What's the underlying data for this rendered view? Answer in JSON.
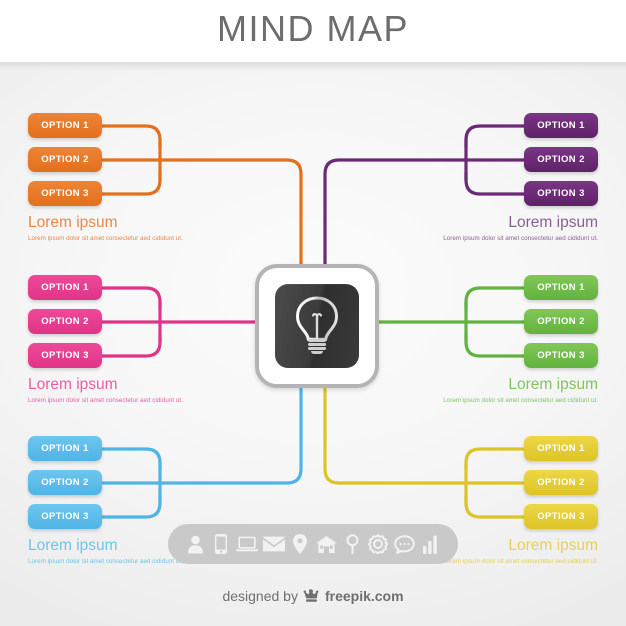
{
  "header": {
    "title": "MIND MAP"
  },
  "center": {
    "icon": "lightbulb-icon",
    "frame_color": "#b4b4b4",
    "tile_color": "#3b3b3b"
  },
  "branches": [
    {
      "id": "orange",
      "position": "top-left",
      "color": "#e8741f",
      "line_color": "#e2701d",
      "text_color": "#e8884a",
      "options": [
        "OPTION 1",
        "OPTION 2",
        "OPTION 3"
      ],
      "caption": {
        "heading": "Lorem ipsum",
        "subtext": "Lorem ipsum dolor sit amet consectetur aed cididunt ut."
      }
    },
    {
      "id": "pink",
      "position": "middle-left",
      "color": "#e5338a",
      "line_color": "#e03487",
      "text_color": "#ef5ba3",
      "options": [
        "OPTION 1",
        "OPTION 2",
        "OPTION 3"
      ],
      "caption": {
        "heading": "Lorem ipsum",
        "subtext": "Lorem ipsum dolor sit amet consectetur aed cididunt ut."
      }
    },
    {
      "id": "blue",
      "position": "bottom-left",
      "color": "#56b9e8",
      "line_color": "#4fb4e6",
      "text_color": "#71c3e9",
      "options": [
        "OPTION 1",
        "OPTION 2",
        "OPTION 3"
      ],
      "caption": {
        "heading": "Lorem ipsum",
        "subtext": "Lorem ipsum dolor sit amet consectetur aed cididunt ut."
      }
    },
    {
      "id": "purple",
      "position": "top-right",
      "color": "#6b2a75",
      "line_color": "#6b2a75",
      "text_color": "#8a5f93",
      "options": [
        "OPTION 1",
        "OPTION 2",
        "OPTION 3"
      ],
      "caption": {
        "heading": "Lorem ipsum",
        "subtext": "Lorem ipsum dolor sit amet consectetur aed cididunt ut."
      }
    },
    {
      "id": "green",
      "position": "middle-right",
      "color": "#6cba45",
      "line_color": "#62b23f",
      "text_color": "#80c45e",
      "options": [
        "OPTION 1",
        "OPTION 2",
        "OPTION 3"
      ],
      "caption": {
        "heading": "Lorem ipsum",
        "subtext": "Lorem ipsum dolor sit amet consectetur aed cididunt ut."
      }
    },
    {
      "id": "yellow",
      "position": "bottom-right",
      "color": "#e3c92c",
      "line_color": "#ddc426",
      "text_color": "#e6d05a",
      "options": [
        "OPTION 1",
        "OPTION 2",
        "OPTION 3"
      ],
      "caption": {
        "heading": "Lorem ipsum",
        "subtext": "Lorem ipsum dolor sit amet consectetur aed cididunt ut."
      }
    }
  ],
  "icon_bar": {
    "background": "#c9c9c9",
    "icons": [
      "user-icon",
      "mobile-phone-icon",
      "laptop-icon",
      "envelope-icon",
      "map-pin-icon",
      "home-icon",
      "balloon-pin-icon",
      "gear-icon",
      "chat-bubble-icon",
      "bar-chart-icon"
    ]
  },
  "footer": {
    "prefix": "designed by",
    "brand": "freepik.com",
    "logo": "freepik-crown-icon"
  }
}
